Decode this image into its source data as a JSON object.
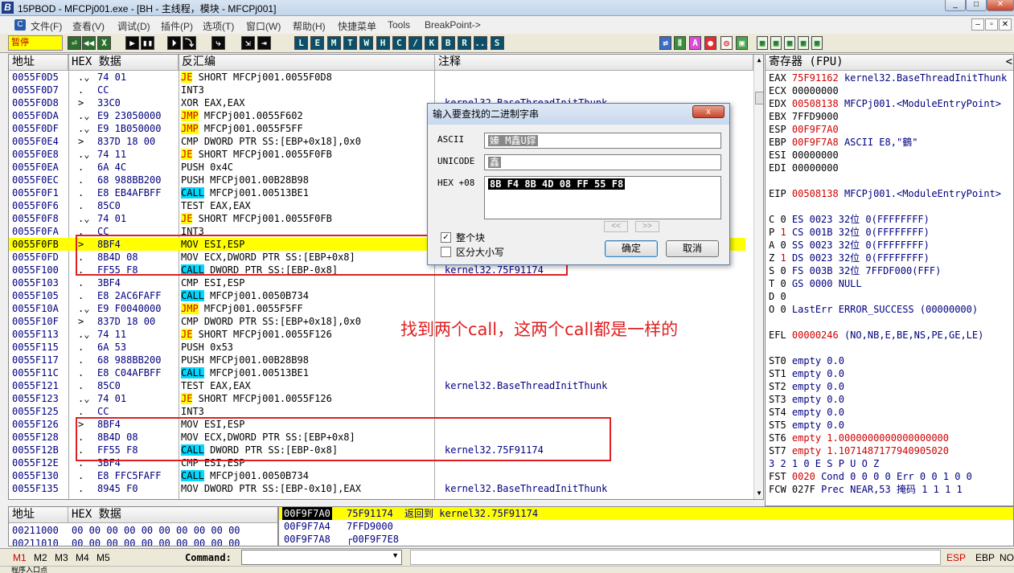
{
  "window": {
    "title": "15PBOD - MFCPj001.exe - [BH - 主线程，模块 - MFCPj001]"
  },
  "menu": [
    "文件(F)",
    "查看(V)",
    "调试(D)",
    "插件(P)",
    "选项(T)",
    "窗口(W)",
    "帮助(H)",
    "快捷菜单",
    "Tools",
    "BreakPoint->"
  ],
  "toolbar": {
    "status": "暂停",
    "buttons1": [
      "⏎",
      "◀◀",
      "X",
      "▶",
      "▮▮",
      "⏵",
      "⤵",
      "⤷",
      "⇲",
      "⇥"
    ],
    "letters": [
      "L",
      "E",
      "M",
      "T",
      "W",
      "H",
      "C",
      "/",
      "K",
      "B",
      "R",
      "...",
      "S"
    ]
  },
  "disasm": {
    "headers": {
      "addr": "地址",
      "hex": "HEX 数据",
      "dis": "反汇编",
      "cmt": "注释"
    },
    "rows": [
      {
        "a": "0055F0D5",
        "m": ".⌄",
        "h": "74 01",
        "k": "JE",
        "kt": "jcc",
        "o": " SHORT MFCPj001.0055F0D8",
        "c": ""
      },
      {
        "a": "0055F0D7",
        "m": ".",
        "h": "CC",
        "k": "",
        "kt": "",
        "o": "INT3",
        "c": ""
      },
      {
        "a": "0055F0D8",
        "m": ">",
        "h": "33C0",
        "k": "",
        "kt": "",
        "o": "XOR EAX,EAX",
        "c": "kernel32.BaseThreadInitThunk"
      },
      {
        "a": "0055F0DA",
        "m": ".⌄",
        "h": "E9 23050000",
        "k": "JMP",
        "kt": "jmp",
        "o": " MFCPj001.0055F602",
        "c": ""
      },
      {
        "a": "0055F0DF",
        "m": ".⌄",
        "h": "E9 1B050000",
        "k": "JMP",
        "kt": "jmp",
        "o": " MFCPj001.0055F5FF",
        "c": ""
      },
      {
        "a": "0055F0E4",
        "m": ">",
        "h": "837D 18 00",
        "k": "",
        "kt": "",
        "o": "CMP DWORD PTR SS:[EBP+0x18],0x0",
        "c": ""
      },
      {
        "a": "0055F0E8",
        "m": ".⌄",
        "h": "74 11",
        "k": "JE",
        "kt": "jcc",
        "o": " SHORT MFCPj001.0055F0FB",
        "c": ""
      },
      {
        "a": "0055F0EA",
        "m": ".",
        "h": "6A 4C",
        "k": "",
        "kt": "",
        "o": "PUSH 0x4C",
        "c": ""
      },
      {
        "a": "0055F0EC",
        "m": ".",
        "h": "68 988BB200",
        "k": "",
        "kt": "",
        "o": "PUSH MFCPj001.00B28B98",
        "c": "",
        "u": true
      },
      {
        "a": "0055F0F1",
        "m": ".",
        "h": "E8 EB4AFBFF",
        "k": "CALL",
        "kt": "call",
        "o": " MFCPj001.00513BE1",
        "c": ""
      },
      {
        "a": "0055F0F6",
        "m": ".",
        "h": "85C0",
        "k": "",
        "kt": "",
        "o": "TEST EAX,EAX",
        "c": ""
      },
      {
        "a": "0055F0F8",
        "m": ".⌄",
        "h": "74 01",
        "k": "JE",
        "kt": "jcc",
        "o": " SHORT MFCPj001.0055F0FB",
        "c": ""
      },
      {
        "a": "0055F0FA",
        "m": ".",
        "h": "CC",
        "k": "",
        "kt": "",
        "o": "INT3",
        "c": ""
      },
      {
        "a": "0055F0FB",
        "m": ">",
        "h": "8BF4",
        "k": "",
        "kt": "",
        "o": "MOV ESI,ESP",
        "c": "",
        "sel": true
      },
      {
        "a": "0055F0FD",
        "m": ".",
        "h": "8B4D 08",
        "k": "",
        "kt": "",
        "o": "MOV ECX,DWORD PTR SS:[EBP+0x8]",
        "c": ""
      },
      {
        "a": "0055F100",
        "m": ".",
        "h": "FF55 F8",
        "k": "CALL",
        "kt": "call",
        "o": " DWORD PTR SS:[EBP-0x8]",
        "c": "kernel32.75F91174"
      },
      {
        "a": "0055F103",
        "m": ".",
        "h": "3BF4",
        "k": "",
        "kt": "",
        "o": "CMP ESI,ESP",
        "c": ""
      },
      {
        "a": "0055F105",
        "m": ".",
        "h": "E8 2AC6FAFF",
        "k": "CALL",
        "kt": "call",
        "o": " MFCPj001.0050B734",
        "c": ""
      },
      {
        "a": "0055F10A",
        "m": ".⌄",
        "h": "E9 F0040000",
        "k": "JMP",
        "kt": "jmp",
        "o": " MFCPj001.0055F5FF",
        "c": ""
      },
      {
        "a": "0055F10F",
        "m": ">",
        "h": "837D 18 00",
        "k": "",
        "kt": "",
        "o": "CMP DWORD PTR SS:[EBP+0x18],0x0",
        "c": ""
      },
      {
        "a": "0055F113",
        "m": ".⌄",
        "h": "74 11",
        "k": "JE",
        "kt": "jcc",
        "o": " SHORT MFCPj001.0055F126",
        "c": ""
      },
      {
        "a": "0055F115",
        "m": ".",
        "h": "6A 53",
        "k": "",
        "kt": "",
        "o": "PUSH 0x53",
        "c": ""
      },
      {
        "a": "0055F117",
        "m": ".",
        "h": "68 988BB200",
        "k": "",
        "kt": "",
        "o": "PUSH MFCPj001.00B28B98",
        "c": "",
        "u": true
      },
      {
        "a": "0055F11C",
        "m": ".",
        "h": "E8 C04AFBFF",
        "k": "CALL",
        "kt": "call",
        "o": " MFCPj001.00513BE1",
        "c": ""
      },
      {
        "a": "0055F121",
        "m": ".",
        "h": "85C0",
        "k": "",
        "kt": "",
        "o": "TEST EAX,EAX",
        "c": "kernel32.BaseThreadInitThunk"
      },
      {
        "a": "0055F123",
        "m": ".⌄",
        "h": "74 01",
        "k": "JE",
        "kt": "jcc",
        "o": " SHORT MFCPj001.0055F126",
        "c": ""
      },
      {
        "a": "0055F125",
        "m": ".",
        "h": "CC",
        "k": "",
        "kt": "",
        "o": "INT3",
        "c": ""
      },
      {
        "a": "0055F126",
        "m": ">",
        "h": "8BF4",
        "k": "",
        "kt": "",
        "o": "MOV ESI,ESP",
        "c": ""
      },
      {
        "a": "0055F128",
        "m": ".",
        "h": "8B4D 08",
        "k": "",
        "kt": "",
        "o": "MOV ECX,DWORD PTR SS:[EBP+0x8]",
        "c": ""
      },
      {
        "a": "0055F12B",
        "m": ".",
        "h": "FF55 F8",
        "k": "CALL",
        "kt": "call",
        "o": " DWORD PTR SS:[EBP-0x8]",
        "c": "kernel32.75F91174"
      },
      {
        "a": "0055F12E",
        "m": ".",
        "h": "3BF4",
        "k": "",
        "kt": "",
        "o": "CMP ESI,ESP",
        "c": ""
      },
      {
        "a": "0055F130",
        "m": ".",
        "h": "E8 FFC5FAFF",
        "k": "CALL",
        "kt": "call",
        "o": " MFCPj001.0050B734",
        "c": ""
      },
      {
        "a": "0055F135",
        "m": ".",
        "h": "8945 F0",
        "k": "",
        "kt": "",
        "o": "MOV DWORD PTR SS:[EBP-0x10],EAX",
        "c": "kernel32.BaseThreadInitThunk"
      }
    ]
  },
  "registers": {
    "header": "寄存器 (FPU)",
    "rows": [
      {
        "n": "EAX",
        "v": "75F91162",
        "d": "kernel32.BaseThreadInitThunk",
        "red": true
      },
      {
        "n": "ECX",
        "v": "00000000",
        "d": "",
        "red": false
      },
      {
        "n": "EDX",
        "v": "00508138",
        "d": "MFCPj001.<ModuleEntryPoint>",
        "red": true
      },
      {
        "n": "EBX",
        "v": "7FFD9000",
        "d": "",
        "red": false
      },
      {
        "n": "ESP",
        "v": "00F9F7A0",
        "d": "",
        "red": true
      },
      {
        "n": "EBP",
        "v": "00F9F7A8",
        "d": "ASCII E8,\"鶴\"",
        "red": true
      },
      {
        "n": "ESI",
        "v": "00000000",
        "d": "",
        "red": false
      },
      {
        "n": "EDI",
        "v": "00000000",
        "d": "",
        "red": false
      },
      {
        "n": "",
        "v": "",
        "d": "",
        "red": false
      },
      {
        "n": "EIP",
        "v": "00508138",
        "d": "MFCPj001.<ModuleEntryPoint>",
        "red": true
      },
      {
        "n": "",
        "v": "",
        "d": "",
        "red": false
      },
      {
        "n": "C 0",
        "v": "",
        "d": "ES 0023 32位 0(FFFFFFFF)",
        "red": false
      },
      {
        "n": "P",
        "v": "1",
        "d": "CS 001B 32位 0(FFFFFFFF)",
        "red": true
      },
      {
        "n": "A 0",
        "v": "",
        "d": "SS 0023 32位 0(FFFFFFFF)",
        "red": false
      },
      {
        "n": "Z",
        "v": "1",
        "d": "DS 0023 32位 0(FFFFFFFF)",
        "red": true
      },
      {
        "n": "S 0",
        "v": "",
        "d": "FS 003B 32位 7FFDF000(FFF)",
        "red": false
      },
      {
        "n": "T 0",
        "v": "",
        "d": "GS 0000 NULL",
        "red": false
      },
      {
        "n": "D 0",
        "v": "",
        "d": "",
        "red": false
      },
      {
        "n": "O 0",
        "v": "",
        "d": "LastErr ERROR_SUCCESS (00000000)",
        "red": false
      },
      {
        "n": "",
        "v": "",
        "d": "",
        "red": false
      },
      {
        "n": "EFL",
        "v": "00000246",
        "d": "(NO,NB,E,BE,NS,PE,GE,LE)",
        "red": true
      },
      {
        "n": "",
        "v": "",
        "d": "",
        "red": false
      },
      {
        "n": "ST0",
        "v": "",
        "d": "empty 0.0",
        "red": false
      },
      {
        "n": "ST1",
        "v": "",
        "d": "empty 0.0",
        "red": false
      },
      {
        "n": "ST2",
        "v": "",
        "d": "empty 0.0",
        "red": false
      },
      {
        "n": "ST3",
        "v": "",
        "d": "empty 0.0",
        "red": false
      },
      {
        "n": "ST4",
        "v": "",
        "d": "empty 0.0",
        "red": false
      },
      {
        "n": "ST5",
        "v": "",
        "d": "empty 0.0",
        "red": false
      },
      {
        "n": "ST6",
        "v": "",
        "d": "empty 1.0000000000000000000",
        "red": false
      },
      {
        "n": "ST7",
        "v": "",
        "d": "empty 1.1071487177940905020",
        "red": false
      },
      {
        "n": "",
        "v": "",
        "d": "3 2 1 0      E S P U O Z",
        "red": false
      },
      {
        "n": "FST",
        "v": "0020",
        "d": "Cond 0 0 0 0  Err 0 0 1 0 0",
        "red": true
      },
      {
        "n": "FCW",
        "v": "027F",
        "d": "Prec NEAR,53  掩码    1 1 1 1",
        "red": false
      }
    ]
  },
  "dump": {
    "headers": {
      "addr": "地址",
      "hex": "HEX 数据"
    },
    "rows": [
      {
        "a": "00211000",
        "h": "00 00 00 00 00 00 00 00 00 00"
      },
      {
        "a": "00211010",
        "h": "00 00 00 00 00 00 00 00 00 00"
      }
    ]
  },
  "stack": {
    "rows": [
      {
        "a": "00F9F7A0",
        "v": "75F91174",
        "c": "返回到 kernel32.75F91174",
        "sel": true
      },
      {
        "a": "00F9F7A4",
        "v": "7FFD9000",
        "c": "",
        "sel": false
      },
      {
        "a": "00F9F7A8",
        "v": "┌00F9F7E8",
        "c": "",
        "sel": false
      }
    ]
  },
  "dialog": {
    "title": "输入要查找的二进制字串",
    "close": "x",
    "ascii_label": "ASCII",
    "ascii_value": "嫀 M鑫U鐣",
    "unicode_label": "UNICODE",
    "unicode_value": "鑫",
    "hex_label": "HEX +08",
    "hex_value": "8B F4 8B 4D 08 FF 55 F8",
    "prev": "<<",
    "next": ">>",
    "whole_block_label": "整个块",
    "whole_block_checked": true,
    "case_label": "区分大小写",
    "case_checked": false,
    "ok_label": "确定",
    "cancel_label": "取消"
  },
  "annotation": "找到两个call，这两个call都是一样的",
  "command": {
    "tabs": [
      "M1",
      "M2",
      "M3",
      "M4",
      "M5"
    ],
    "label": "Command:",
    "value": "",
    "right": [
      "ESP",
      "EBP",
      "NO"
    ]
  },
  "status_text": "程序入口点"
}
